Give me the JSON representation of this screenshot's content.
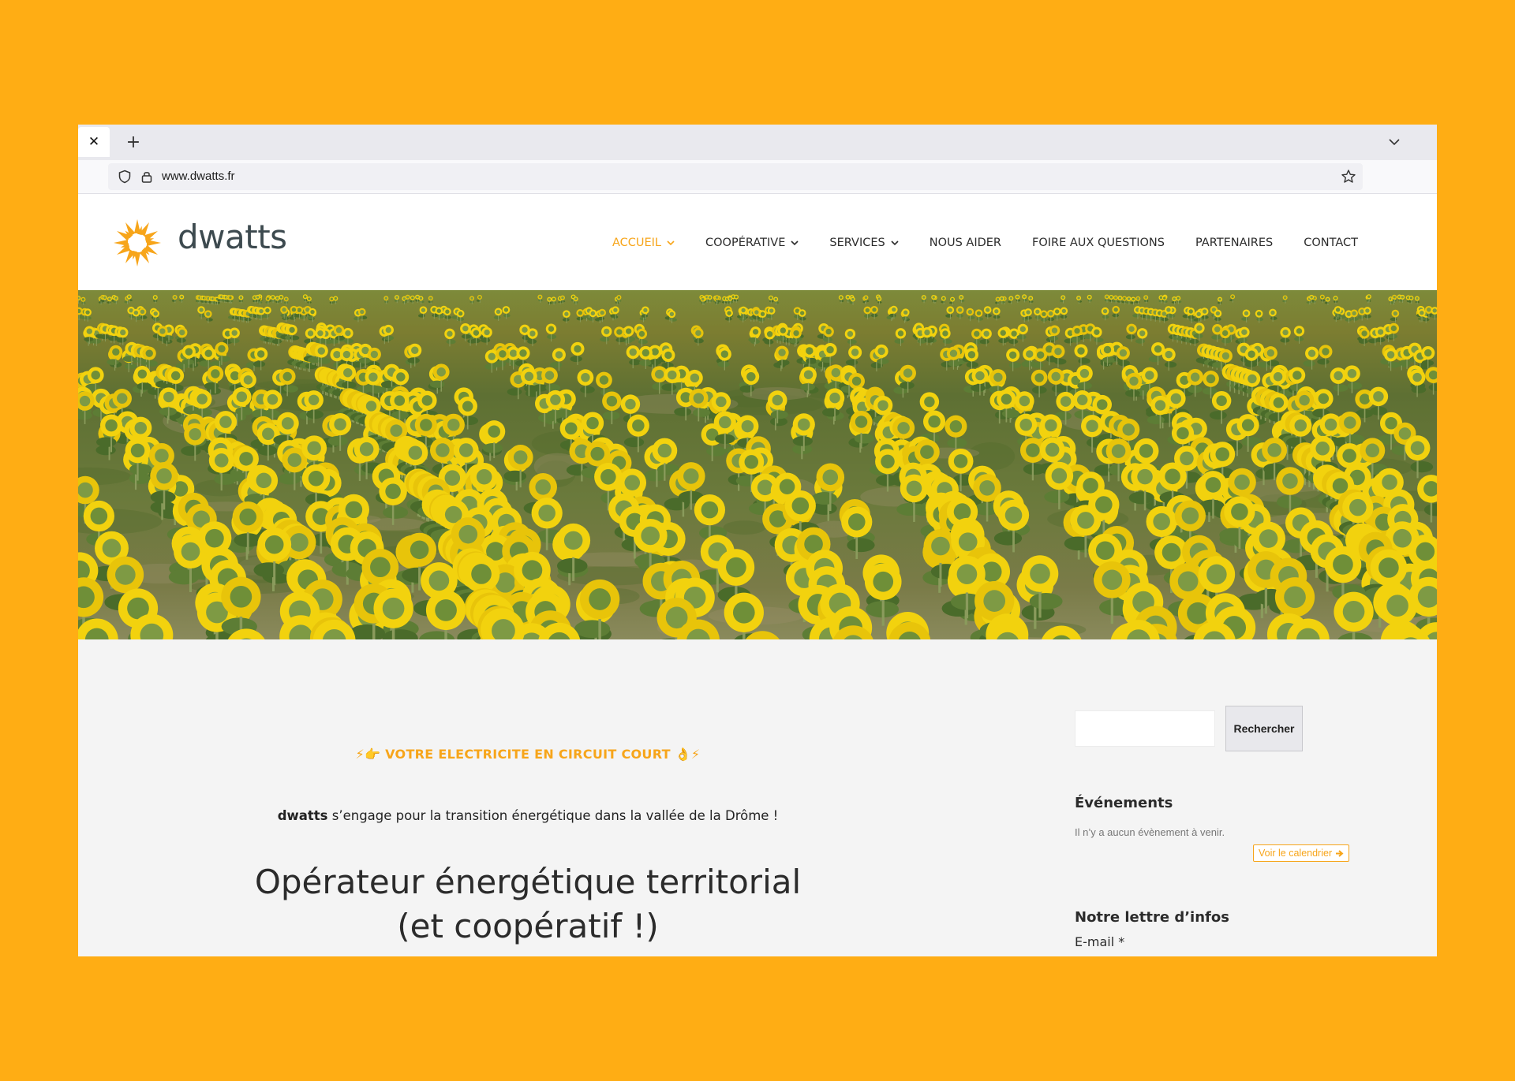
{
  "browser": {
    "tab_close": "✕",
    "new_tab": "+",
    "url": "www.dwatts.fr"
  },
  "site": {
    "logo_text": "dwatts",
    "menu": [
      {
        "label": "ACCUEIL",
        "active": true,
        "has_dropdown": true
      },
      {
        "label": "COOPÉRATIVE",
        "active": false,
        "has_dropdown": true
      },
      {
        "label": "SERVICES",
        "active": false,
        "has_dropdown": true
      },
      {
        "label": "NOUS AIDER",
        "active": false,
        "has_dropdown": false
      },
      {
        "label": "FOIRE AUX QUESTIONS",
        "active": false,
        "has_dropdown": false
      },
      {
        "label": "PARTENAIRES",
        "active": false,
        "has_dropdown": false
      },
      {
        "label": "CONTACT",
        "active": false,
        "has_dropdown": false
      }
    ]
  },
  "main": {
    "tagline": "⚡👉 VOTRE ELECTRICITE EN CIRCUIT COURT 👌⚡",
    "intro_brand": "dwatts",
    "intro_rest": " s’engage pour la transition énergétique dans la vallée de la Drôme !",
    "headline_line1": "Opérateur énergétique territorial",
    "headline_line2": "(et coopératif !)"
  },
  "sidebar": {
    "search_value": "",
    "search_button": "Rechercher",
    "events_title": "Événements",
    "events_empty": "Il n’y a aucun évènement à venir.",
    "calendar_button": "Voir le calendrier",
    "newsletter_title": "Notre lettre d’infos",
    "email_label": "E-mail *"
  },
  "colors": {
    "background": "#ffad14",
    "accent": "#f7a51a",
    "text": "#2b2b2b"
  },
  "icons": {
    "shield": "shield-icon",
    "lock": "lock-icon",
    "star": "star-icon",
    "tab_list": "chevron-down-icon",
    "logo": "sun-logo-icon",
    "hero": "sunflower-field-image"
  }
}
